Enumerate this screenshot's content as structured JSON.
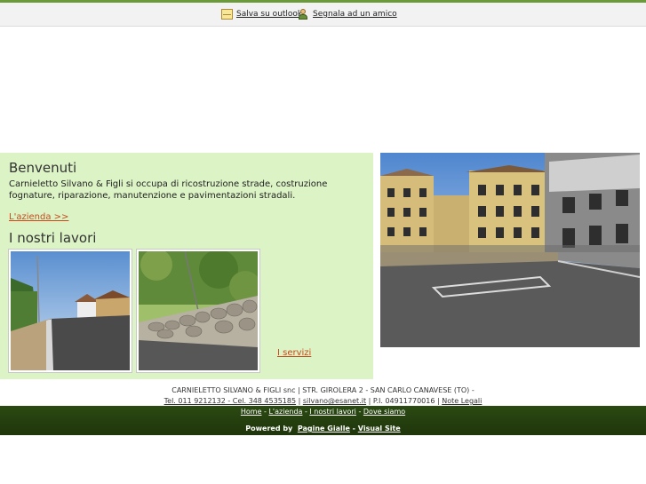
{
  "toolbar": {
    "save_outlook": "Salva su outlook",
    "tell_friend": "Segnala ad un amico"
  },
  "main": {
    "welcome_title": "Benvenuti",
    "intro_text": "Carnieletto Silvano & Figli si occupa di ricostruzione strade, costruzione fognature, riparazione, manutenzione e pavimentazioni stradali.",
    "azienda_link": "L'azienda >>",
    "works_title": "I nostri lavori",
    "servizi_link": "I servizi"
  },
  "footer": {
    "company_line": "CARNIELETTO SILVANO & FIGLI snc | STR. GIROLERA 2 - SAN CARLO CANAVESE (TO) -",
    "phone": "Tel. 011 9212132 - Cel. 348 4535185",
    "sep1": " | ",
    "email": "silvano@esanet.it",
    "piva": " | P.I. 04911770016 | ",
    "legal": "Note Legali",
    "nav": [
      "Home",
      "L'azienda",
      "I nostri lavori",
      "Dove siamo"
    ],
    "nav_sep": " - ",
    "powered_prefix": "Powered by",
    "powered_by": "Pagine Gialle",
    "powered_sep": " - ",
    "visual_site": "Visual Site"
  },
  "colors": {
    "content_bg": "#dbf3c5",
    "link": "#c7491c",
    "footer_bar": "#2b4a12"
  }
}
